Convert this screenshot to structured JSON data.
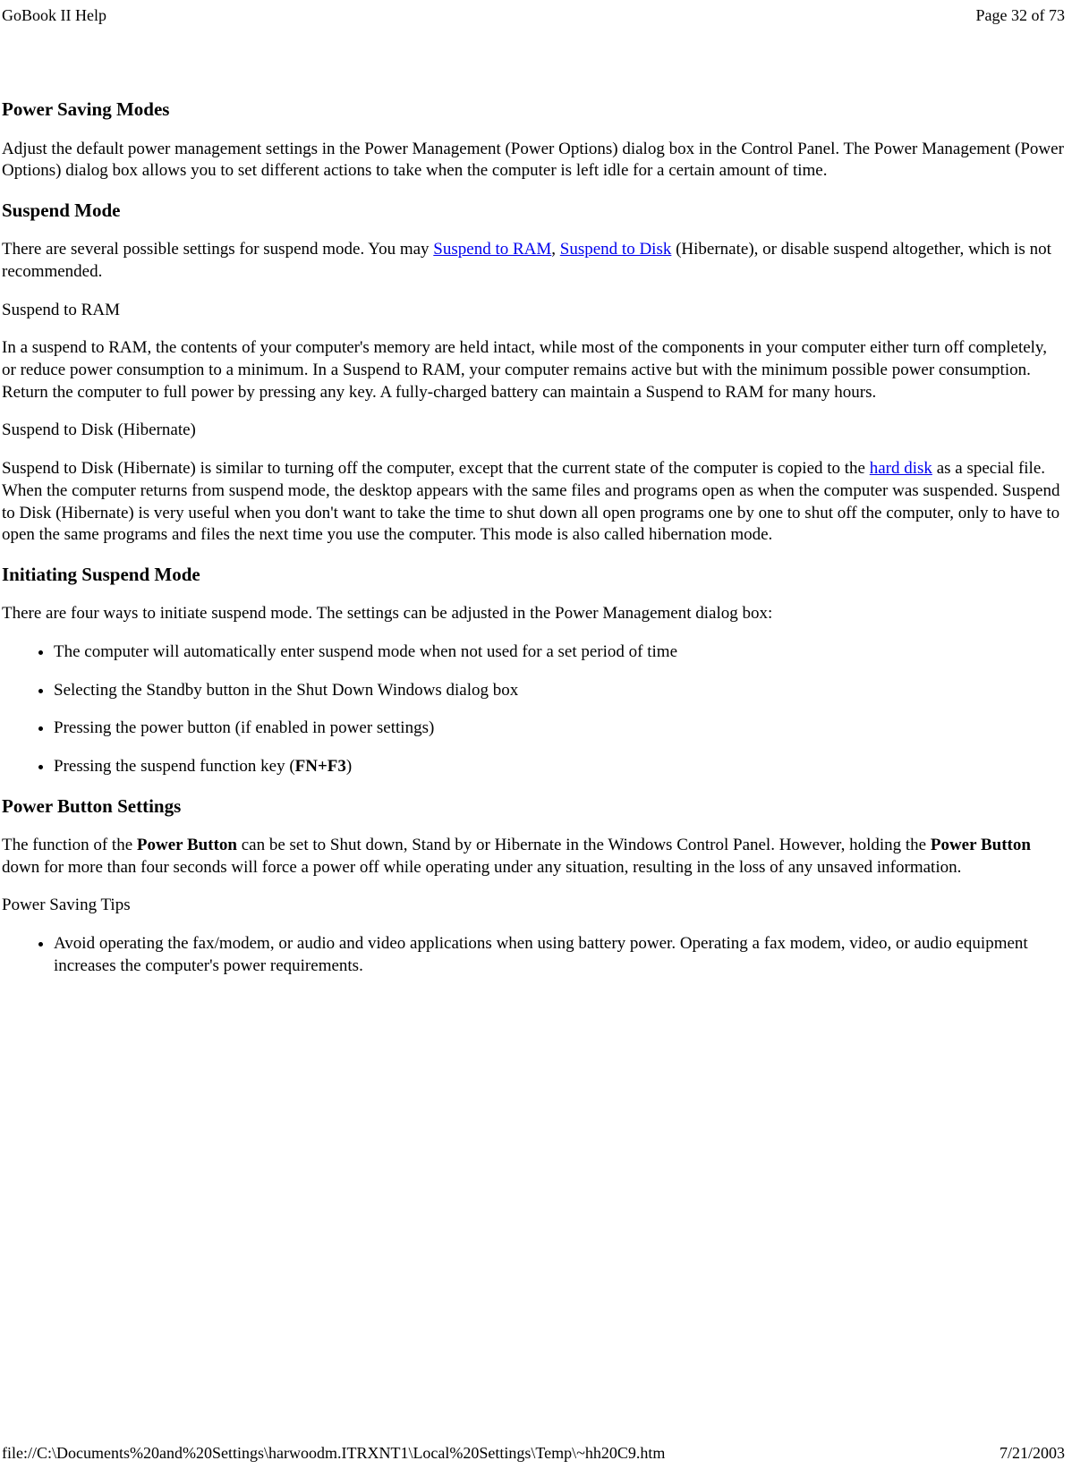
{
  "header": {
    "title": "GoBook II Help",
    "page_info": "Page 32 of 73"
  },
  "sections": {
    "power_saving_modes": {
      "heading": "Power Saving Modes",
      "para": "Adjust the default power management settings in the Power Management (Power Options) dialog box in the Control Panel.  The Power Management (Power Options) dialog box allows you to set different actions to take when the computer is left idle for a certain amount of time."
    },
    "suspend_mode": {
      "heading": "Suspend Mode",
      "para_part1": "There are several possible settings for suspend mode.  You may ",
      "link1": "Suspend to RAM",
      "para_part2": ", ",
      "link2": "Suspend to Disk",
      "para_part3": " (Hibernate), or disable suspend altogether, which is not recommended.",
      "sub1_heading": "Suspend to RAM",
      "sub1_para": "In a suspend to RAM, the contents of your computer's memory are held intact, while most of the components in your computer either turn off completely, or reduce power consumption to a minimum. In a Suspend to RAM, your computer remains active but with the minimum possible power consumption. Return the computer to full power by pressing any key. A fully-charged battery can maintain a Suspend to RAM for many hours.",
      "sub2_heading": "Suspend to Disk (Hibernate)",
      "sub2_para_part1": "Suspend to Disk (Hibernate) is similar to turning off the computer, except that the current state of the computer is copied to the ",
      "sub2_link": "hard disk",
      "sub2_para_part2": " as a special file. When the computer returns from suspend mode, the desktop appears with the same files and programs open as when the computer was suspended. Suspend to Disk (Hibernate) is very useful when you don't want to take the time to shut down all open programs one by one to shut off the computer, only to have to open the same programs and files the next time you use the computer. This mode is also called hibernation mode."
    },
    "initiating": {
      "heading": "Initiating Suspend Mode",
      "para": "There are four ways to initiate suspend mode. The settings can be adjusted in the Power Management dialog box:",
      "items": [
        "The computer will automatically enter suspend mode when not used for a set period of time",
        "Selecting the Standby button in the Shut Down Windows dialog box",
        "Pressing the power button (if enabled in power settings)"
      ],
      "item4_part1": "Pressing the suspend function key (",
      "item4_bold": "FN+F3",
      "item4_part2": ")"
    },
    "power_button": {
      "heading": "Power Button Settings",
      "para_part1": "The function of the ",
      "bold1": "Power Button",
      "para_part2": " can be set to Shut down, Stand by or Hibernate in the Windows Control Panel.  However, holding the ",
      "bold2": "Power Button",
      "para_part3": " down for more than four seconds will force a power off while operating under any situation, resulting in the loss of any unsaved information.",
      "tips_heading": "Power Saving Tips",
      "tip1": "Avoid operating the fax/modem, or audio and video applications when using battery power. Operating a fax modem, video, or audio equipment increases the computer's power requirements."
    }
  },
  "footer": {
    "path": "file://C:\\Documents%20and%20Settings\\harwoodm.ITRXNT1\\Local%20Settings\\Temp\\~hh20C9.htm",
    "date": "7/21/2003"
  }
}
